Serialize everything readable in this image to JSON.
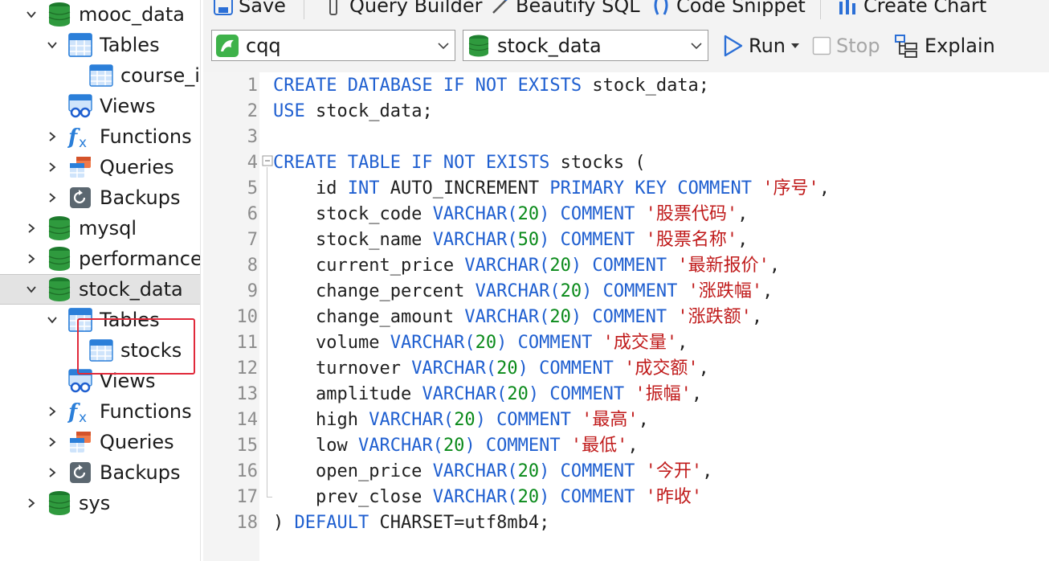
{
  "toolbar_top": {
    "save_label": "Save",
    "query_builder_label": "Query Builder",
    "beautify_label": "Beautify SQL",
    "code_snippet_label": "Code Snippet",
    "create_chart_label": "Create Chart"
  },
  "toolbar": {
    "connection_value": "cqq",
    "database_value": "stock_data",
    "run_label": "Run",
    "stop_label": "Stop",
    "explain_label": "Explain",
    "stop_enabled": false
  },
  "sidebar": {
    "items": [
      {
        "label": "mooc_data",
        "icon": "database-icon",
        "expanded": true
      },
      {
        "label": "Tables",
        "icon": "tables-icon",
        "expanded": true
      },
      {
        "label": "course_i",
        "icon": "table-icon"
      },
      {
        "label": "Views",
        "icon": "views-icon"
      },
      {
        "label": "Functions",
        "icon": "functions-icon",
        "expanded": false
      },
      {
        "label": "Queries",
        "icon": "queries-icon",
        "expanded": false
      },
      {
        "label": "Backups",
        "icon": "backups-icon",
        "expanded": false
      },
      {
        "label": "mysql",
        "icon": "database-icon",
        "expanded": false
      },
      {
        "label": "performance_",
        "icon": "database-icon",
        "expanded": false
      },
      {
        "label": "stock_data",
        "icon": "database-icon",
        "expanded": true,
        "selected": true
      },
      {
        "label": "Tables",
        "icon": "tables-icon",
        "expanded": true
      },
      {
        "label": "stocks",
        "icon": "table-icon",
        "highlighted": true
      },
      {
        "label": "Views",
        "icon": "views-icon"
      },
      {
        "label": "Functions",
        "icon": "functions-icon",
        "expanded": false
      },
      {
        "label": "Queries",
        "icon": "queries-icon",
        "expanded": false
      },
      {
        "label": "Backups",
        "icon": "backups-icon",
        "expanded": false
      },
      {
        "label": "sys",
        "icon": "database-icon",
        "expanded": false
      }
    ]
  },
  "editor": {
    "line_numbers": [
      "1",
      "2",
      "3",
      "4",
      "5",
      "6",
      "7",
      "8",
      "9",
      "10",
      "11",
      "12",
      "13",
      "14",
      "15",
      "16",
      "17",
      "18"
    ],
    "lines": [
      [
        [
          "kw",
          "CREATE DATABASE IF NOT EXISTS"
        ],
        [
          "t",
          " stock_data;"
        ]
      ],
      [
        [
          "kw",
          "USE"
        ],
        [
          "t",
          " stock_data;"
        ]
      ],
      [],
      [
        [
          "kw",
          "CREATE TABLE IF NOT EXISTS"
        ],
        [
          "t",
          " stocks ("
        ]
      ],
      [
        [
          "t",
          "    id "
        ],
        [
          "kw",
          "INT"
        ],
        [
          "t",
          " AUTO_INCREMENT "
        ],
        [
          "kw",
          "PRIMARY KEY COMMENT"
        ],
        [
          "t",
          " "
        ],
        [
          "str",
          "'序号'"
        ],
        [
          "t",
          ","
        ]
      ],
      [
        [
          "t",
          "    stock_code "
        ],
        [
          "kw",
          "VARCHAR("
        ],
        [
          "num",
          "20"
        ],
        [
          "kw",
          ") COMMENT"
        ],
        [
          "t",
          " "
        ],
        [
          "str",
          "'股票代码'"
        ],
        [
          "t",
          ","
        ]
      ],
      [
        [
          "t",
          "    stock_name "
        ],
        [
          "kw",
          "VARCHAR("
        ],
        [
          "num",
          "50"
        ],
        [
          "kw",
          ") COMMENT"
        ],
        [
          "t",
          " "
        ],
        [
          "str",
          "'股票名称'"
        ],
        [
          "t",
          ","
        ]
      ],
      [
        [
          "t",
          "    current_price "
        ],
        [
          "kw",
          "VARCHAR("
        ],
        [
          "num",
          "20"
        ],
        [
          "kw",
          ") COMMENT"
        ],
        [
          "t",
          " "
        ],
        [
          "str",
          "'最新报价'"
        ],
        [
          "t",
          ","
        ]
      ],
      [
        [
          "t",
          "    change_percent "
        ],
        [
          "kw",
          "VARCHAR("
        ],
        [
          "num",
          "20"
        ],
        [
          "kw",
          ") COMMENT"
        ],
        [
          "t",
          " "
        ],
        [
          "str",
          "'涨跌幅'"
        ],
        [
          "t",
          ","
        ]
      ],
      [
        [
          "t",
          "    change_amount "
        ],
        [
          "kw",
          "VARCHAR("
        ],
        [
          "num",
          "20"
        ],
        [
          "kw",
          ") COMMENT"
        ],
        [
          "t",
          " "
        ],
        [
          "str",
          "'涨跌额'"
        ],
        [
          "t",
          ","
        ]
      ],
      [
        [
          "t",
          "    volume "
        ],
        [
          "kw",
          "VARCHAR("
        ],
        [
          "num",
          "20"
        ],
        [
          "kw",
          ") COMMENT"
        ],
        [
          "t",
          " "
        ],
        [
          "str",
          "'成交量'"
        ],
        [
          "t",
          ","
        ]
      ],
      [
        [
          "t",
          "    turnover "
        ],
        [
          "kw",
          "VARCHAR("
        ],
        [
          "num",
          "20"
        ],
        [
          "kw",
          ") COMMENT"
        ],
        [
          "t",
          " "
        ],
        [
          "str",
          "'成交额'"
        ],
        [
          "t",
          ","
        ]
      ],
      [
        [
          "t",
          "    amplitude "
        ],
        [
          "kw",
          "VARCHAR("
        ],
        [
          "num",
          "20"
        ],
        [
          "kw",
          ") COMMENT"
        ],
        [
          "t",
          " "
        ],
        [
          "str",
          "'振幅'"
        ],
        [
          "t",
          ","
        ]
      ],
      [
        [
          "t",
          "    high "
        ],
        [
          "kw",
          "VARCHAR("
        ],
        [
          "num",
          "20"
        ],
        [
          "kw",
          ") COMMENT"
        ],
        [
          "t",
          " "
        ],
        [
          "str",
          "'最高'"
        ],
        [
          "t",
          ","
        ]
      ],
      [
        [
          "t",
          "    low "
        ],
        [
          "kw",
          "VARCHAR("
        ],
        [
          "num",
          "20"
        ],
        [
          "kw",
          ") COMMENT"
        ],
        [
          "t",
          " "
        ],
        [
          "str",
          "'最低'"
        ],
        [
          "t",
          ","
        ]
      ],
      [
        [
          "t",
          "    open_price "
        ],
        [
          "kw",
          "VARCHAR("
        ],
        [
          "num",
          "20"
        ],
        [
          "kw",
          ") COMMENT"
        ],
        [
          "t",
          " "
        ],
        [
          "str",
          "'今开'"
        ],
        [
          "t",
          ","
        ]
      ],
      [
        [
          "t",
          "    prev_close "
        ],
        [
          "kw",
          "VARCHAR("
        ],
        [
          "num",
          "20"
        ],
        [
          "kw",
          ") COMMENT"
        ],
        [
          "t",
          " "
        ],
        [
          "str",
          "'昨收'"
        ]
      ],
      [
        [
          "t",
          ") "
        ],
        [
          "kw",
          "DEFAULT"
        ],
        [
          "t",
          " CHARSET=utf8mb4;"
        ]
      ]
    ]
  },
  "colors": {
    "keyword": "#1f5fd0",
    "string": "#c01b1b",
    "number": "#0a8a1a",
    "highlight_box": "#e0293a",
    "selected_row": "#e3e3e3"
  }
}
